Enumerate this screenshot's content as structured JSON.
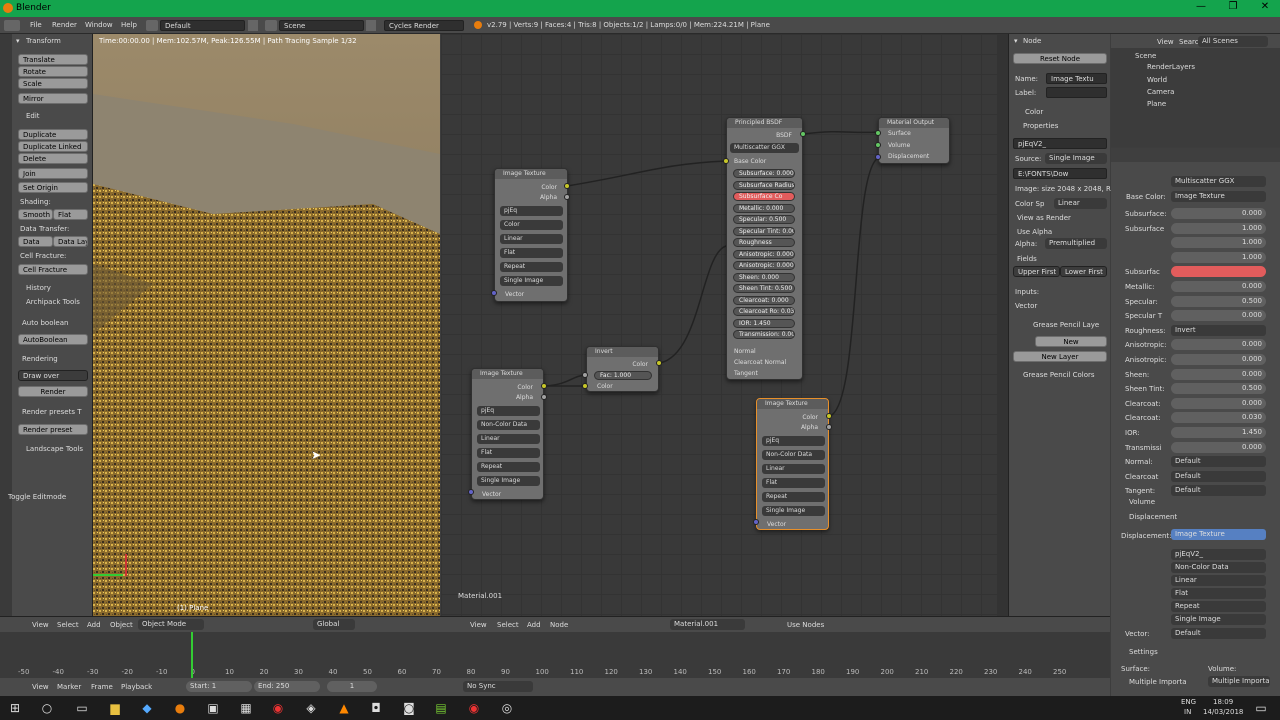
{
  "window": {
    "title": "Blender",
    "min": "—",
    "max": "❐",
    "close": "✕"
  },
  "menu": {
    "file": "File",
    "render": "Render",
    "window": "Window",
    "help": "Help",
    "layout": "Default",
    "scene": "Scene",
    "engine": "Cycles Render",
    "stats": "v2.79 | Verts:9 | Faces:4 | Tris:8 | Objects:1/2 | Lamps:0/0 | Mem:224.21M | Plane"
  },
  "viewport": {
    "render_status": "Time:00:00.00 | Mem:102.57M, Peak:126.55M | Path Tracing Sample 1/32",
    "object_label": "(1) Plane"
  },
  "toolshelf": {
    "transform_header": "Transform",
    "translate": "Translate",
    "rotate": "Rotate",
    "scale": "Scale",
    "mirror": "Mirror",
    "edit_header": "Edit",
    "duplicate": "Duplicate",
    "duplicate_linked": "Duplicate Linked",
    "delete": "Delete",
    "join": "Join",
    "set_origin": "Set Origin",
    "shading_label": "Shading:",
    "smooth": "Smooth",
    "flat": "Flat",
    "data_transfer_label": "Data Transfer:",
    "data": "Data",
    "data_lay": "Data Lay",
    "cell_fracture_label": "Cell Fracture:",
    "cell_fracture": "Cell Fracture",
    "history_header": "History",
    "archipack_header": "Archipack Tools",
    "auto_boolean_label": "Auto boolean",
    "auto_boolean": "AutoBoolean",
    "rendering_label": "Rendering",
    "draw_over": "Draw over",
    "render": "Render",
    "render_presets_label": "Render presets T",
    "render_preset": "Render preset",
    "landscape_header": "Landscape Tools",
    "toggle_editmode": "Toggle Editmode"
  },
  "nodes": {
    "principled": {
      "title": "Principled BSDF",
      "out": "BSDF",
      "dist": "Multiscatter GGX",
      "base_color": "Base Color",
      "rows": [
        {
          "label": "Subsurface:",
          "val": "0.000"
        },
        {
          "label": "Subsurface Radius",
          "val": ""
        },
        {
          "label": "Subsurface Co",
          "val": ""
        },
        {
          "label": "Metallic:",
          "val": "0.000"
        },
        {
          "label": "Specular:",
          "val": "0.500"
        },
        {
          "label": "Specular Tint:",
          "val": "0.000"
        },
        {
          "label": "Roughness",
          "val": ""
        },
        {
          "label": "Anisotropic:",
          "val": "0.000"
        },
        {
          "label": "Anisotropic:",
          "val": "0.000"
        },
        {
          "label": "Sheen:",
          "val": "0.000"
        },
        {
          "label": "Sheen Tint:",
          "val": "0.500"
        },
        {
          "label": "Clearcoat:",
          "val": "0.000"
        },
        {
          "label": "Clearcoat Ro:",
          "val": "0.030"
        },
        {
          "label": "IOR:",
          "val": "1.450"
        },
        {
          "label": "Transmission:",
          "val": "0.000"
        }
      ],
      "normal": "Normal",
      "clearcoat_normal": "Clearcoat Normal",
      "tangent": "Tangent"
    },
    "output": {
      "title": "Material Output",
      "surface": "Surface",
      "volume": "Volume",
      "displacement": "Displacement"
    },
    "tex1": {
      "title": "Image Texture",
      "color": "Color",
      "alpha": "Alpha",
      "img": "pjEq",
      "cs": "Color",
      "interp": "Linear",
      "proj": "Flat",
      "ext": "Repeat",
      "src": "Single Image",
      "vector": "Vector"
    },
    "tex2": {
      "title": "Image Texture",
      "color": "Color",
      "alpha": "Alpha",
      "img": "pjEq",
      "cs": "Non-Color Data",
      "interp": "Linear",
      "proj": "Flat",
      "ext": "Repeat",
      "src": "Single Image",
      "vector": "Vector"
    },
    "tex3": {
      "title": "Image Texture",
      "color": "Color",
      "alpha": "Alpha",
      "img": "pjEq",
      "cs": "Non-Color Data",
      "interp": "Linear",
      "proj": "Flat",
      "ext": "Repeat",
      "src": "Single Image",
      "vector": "Vector"
    },
    "invert": {
      "title": "Invert",
      "color": "Color",
      "fac": "Fac:",
      "fac_val": "1.000",
      "color_in": "Color"
    },
    "material_label": "Material.001"
  },
  "nprops": {
    "node_header": "Node",
    "reset": "Reset Node",
    "name_label": "Name:",
    "name_val": "Image Textu",
    "label_label": "Label:",
    "color_header": "Color",
    "properties_header": "Properties",
    "img": "pjEqV2_",
    "source_label": "Source:",
    "source_val": "Single Image",
    "path": "E:\\FONTS\\Dow",
    "info": "Image: size 2048 x 2048, R",
    "colorsp_label": "Color Sp",
    "colorsp_val": "Linear",
    "view_render": "View as Render",
    "use_alpha": "Use Alpha",
    "alpha_label": "Alpha:",
    "alpha_val": "Premultiplied",
    "fields": "Fields",
    "upper_first": "Upper First",
    "lower_first": "Lower First",
    "inputs": "Inputs:",
    "vector": "Vector",
    "gp_layers": "Grease Pencil Laye",
    "new": "New",
    "new_layer": "New Layer",
    "gp_colors": "Grease Pencil Colors"
  },
  "outliner": {
    "view": "View",
    "search": "Search",
    "all_scenes": "All Scenes",
    "scene": "Scene",
    "renderlayers": "RenderLayers",
    "world": "World",
    "camera": "Camera",
    "plane": "Plane"
  },
  "props": {
    "dist": "Multiscatter GGX",
    "base_color_label": "Base Color:",
    "base_color_val": "Image Texture",
    "rows": [
      {
        "label": "Subsurface:",
        "val": "0.000"
      },
      {
        "label": "Subsurface",
        "val": "1.000"
      },
      {
        "label": "",
        "val": "1.000"
      },
      {
        "label": "",
        "val": "1.000"
      },
      {
        "label": "Subsurfac",
        "val": ""
      },
      {
        "label": "Metallic:",
        "val": "0.000"
      },
      {
        "label": "Specular:",
        "val": "0.500"
      },
      {
        "label": "Specular T",
        "val": "0.000"
      },
      {
        "label": "Roughness:",
        "val": "Invert"
      },
      {
        "label": "Anisotropic:",
        "val": "0.000"
      },
      {
        "label": "Anisotropic:",
        "val": "0.000"
      },
      {
        "label": "Sheen:",
        "val": "0.000"
      },
      {
        "label": "Sheen Tint:",
        "val": "0.500"
      },
      {
        "label": "Clearcoat:",
        "val": "0.000"
      },
      {
        "label": "Clearcoat:",
        "val": "0.030"
      },
      {
        "label": "IOR:",
        "val": "1.450"
      },
      {
        "label": "Transmissi",
        "val": "0.000"
      },
      {
        "label": "Normal:",
        "val": "Default"
      },
      {
        "label": "Clearcoat",
        "val": "Default"
      },
      {
        "label": "Tangent:",
        "val": "Default"
      }
    ],
    "volume": "Volume",
    "displacement_header": "Displacement",
    "displacement_label": "Displacement:",
    "displacement_val": "Image Texture",
    "img": "pjEqV2_",
    "disp_rows": [
      "Non-Color Data",
      "Linear",
      "Flat",
      "Repeat",
      "Single Image"
    ],
    "vector_label": "Vector:",
    "vector_val": "Default",
    "settings": "Settings",
    "surface_label": "Surface:",
    "volume_label": "Volume:",
    "mult_imp": "Multiple Importa",
    "mult_imp2": "Multiple Importance"
  },
  "header3d": {
    "view": "View",
    "select": "Select",
    "add": "Add",
    "object": "Object",
    "mode": "Object Mode",
    "orient": "Global"
  },
  "headernode": {
    "view": "View",
    "select": "Select",
    "add": "Add",
    "node": "Node",
    "material": "Material.001",
    "use_nodes": "Use Nodes"
  },
  "timeline": {
    "ticks": [
      "-50",
      "-40",
      "-30",
      "-20",
      "-10",
      "0",
      "10",
      "20",
      "30",
      "40",
      "50",
      "60",
      "70",
      "80",
      "90",
      "100",
      "110",
      "120",
      "130",
      "140",
      "150",
      "160",
      "170",
      "180",
      "190",
      "200",
      "210",
      "220",
      "230",
      "240",
      "250"
    ],
    "view": "View",
    "marker": "Marker",
    "frame": "Frame",
    "playback": "Playback",
    "start": "Start:",
    "start_val": "1",
    "end": "End:",
    "end_val": "250",
    "cur": "1",
    "sync": "No Sync"
  },
  "taskbar": {
    "time": "18:09",
    "date": "14/03/2018",
    "lang1": "ENG",
    "lang2": "IN"
  },
  "colors": {
    "accent": "#5680c2",
    "subsurface_color": "#e25c5c",
    "title_green": "#14a44d"
  }
}
